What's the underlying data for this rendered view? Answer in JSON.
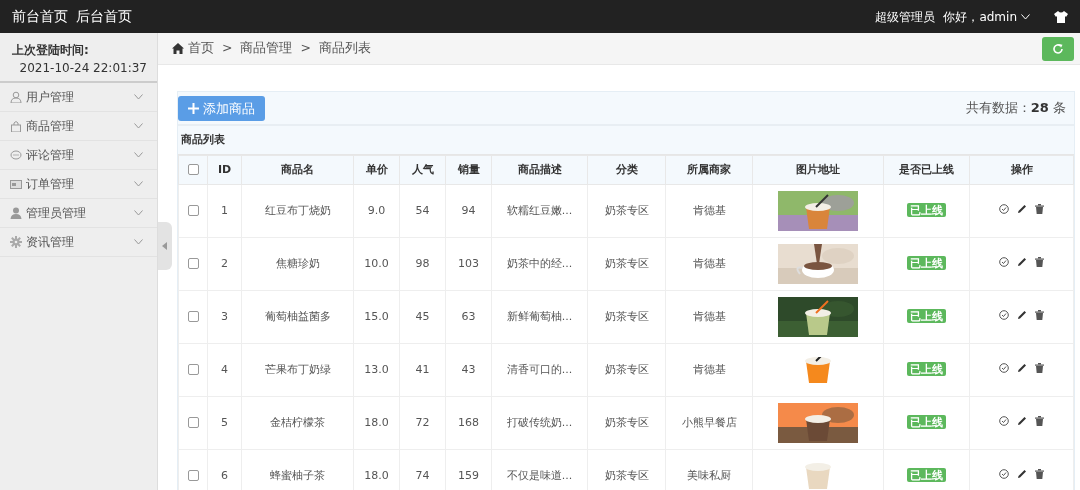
{
  "topbar": {
    "links": [
      "前台首页",
      "后台首页"
    ],
    "role": "超级管理员",
    "greeting": "你好，admin"
  },
  "sidebar": {
    "last_login_label": "上次登陆时间:",
    "last_login_time": "2021-10-24 22:01:37",
    "items": [
      {
        "label": "用户管理",
        "expanded": false
      },
      {
        "label": "商品管理",
        "expanded": false
      },
      {
        "label": "评论管理",
        "expanded": false
      },
      {
        "label": "订单管理",
        "expanded": false
      },
      {
        "label": "管理员管理",
        "expanded": false
      },
      {
        "label": "资讯管理",
        "expanded": false
      }
    ]
  },
  "breadcrumb": [
    "首页",
    "商品管理",
    "商品列表"
  ],
  "breadcrumb_separator": ">",
  "toolbar": {
    "add_button": "添加商品",
    "total_label": "共有数据：",
    "total_count": "28",
    "total_unit": "条"
  },
  "table": {
    "title": "商品列表",
    "select_all_checked": false,
    "columns": [
      "ID",
      "商品名",
      "单价",
      "人气",
      "销量",
      "商品描述",
      "分类",
      "所属商家",
      "图片地址",
      "是否已上线",
      "操作"
    ],
    "rows": [
      {
        "checked": false,
        "id": "1",
        "name": "红豆布丁烧奶",
        "price": "9.0",
        "popularity": "54",
        "sales": "94",
        "description": "软糯红豆嫩...",
        "category": "奶茶专区",
        "merchant": "肯德基",
        "online": true,
        "status": "已上线"
      },
      {
        "checked": false,
        "id": "2",
        "name": "焦糖珍奶",
        "price": "10.0",
        "popularity": "98",
        "sales": "103",
        "description": "奶茶中的经...",
        "category": "奶茶专区",
        "merchant": "肯德基",
        "online": true,
        "status": "已上线"
      },
      {
        "checked": false,
        "id": "3",
        "name": "葡萄柚益菌多",
        "price": "15.0",
        "popularity": "45",
        "sales": "63",
        "description": "新鲜葡萄柚...",
        "category": "奶茶专区",
        "merchant": "肯德基",
        "online": true,
        "status": "已上线"
      },
      {
        "checked": false,
        "id": "4",
        "name": "芒果布丁奶绿",
        "price": "13.0",
        "popularity": "41",
        "sales": "43",
        "description": "清香可口的...",
        "category": "奶茶专区",
        "merchant": "肯德基",
        "online": true,
        "status": "已上线"
      },
      {
        "checked": false,
        "id": "5",
        "name": "金桔柠檬茶",
        "price": "18.0",
        "popularity": "72",
        "sales": "168",
        "description": "打破传统奶...",
        "category": "奶茶专区",
        "merchant": "小熊早餐店",
        "online": true,
        "status": "已上线"
      },
      {
        "checked": false,
        "id": "6",
        "name": "蜂蜜柚子茶",
        "price": "18.0",
        "popularity": "74",
        "sales": "159",
        "description": "不仅是味道...",
        "category": "奶茶专区",
        "merchant": "美味私厨",
        "online": true,
        "status": "已上线"
      }
    ]
  }
}
